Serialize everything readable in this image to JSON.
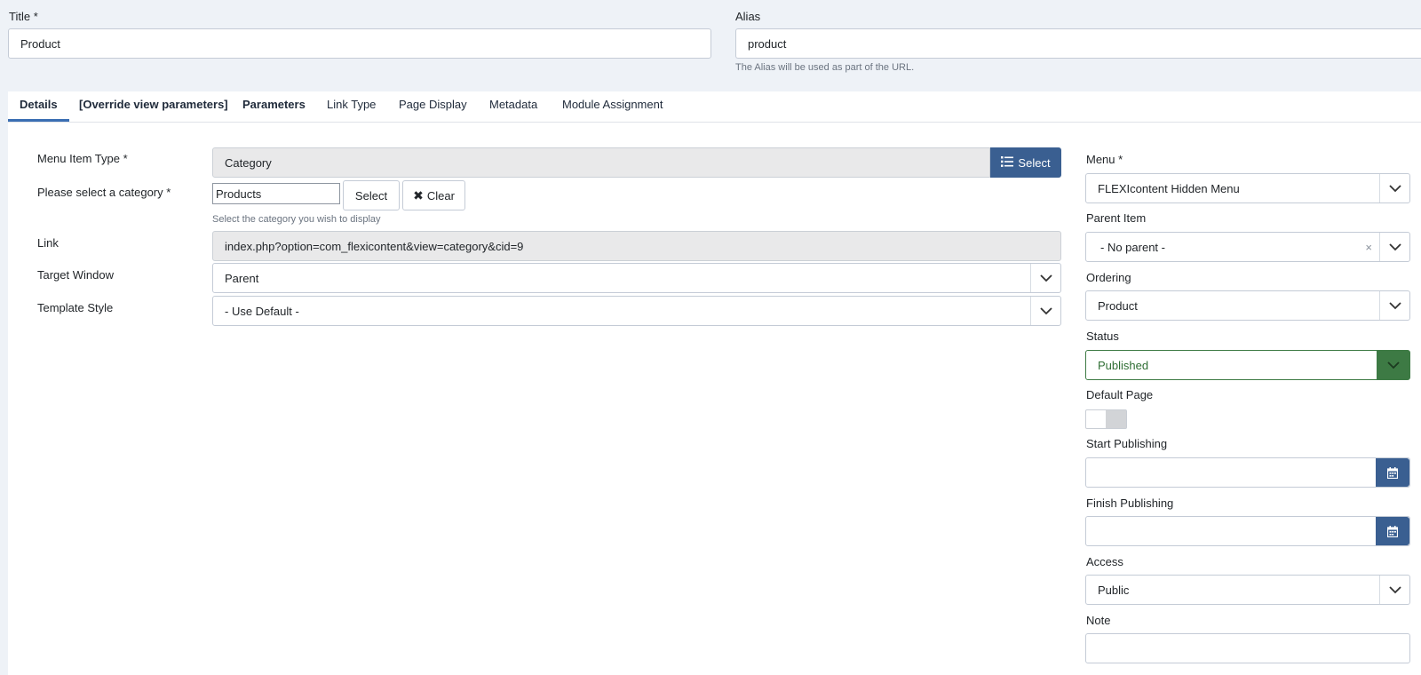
{
  "header": {
    "title_label": "Title *",
    "title_value": "Product",
    "alias_label": "Alias",
    "alias_value": "product",
    "alias_help": "The Alias will be used as part of the URL."
  },
  "tabs": [
    {
      "label": "Details"
    },
    {
      "label": "[Override view parameters]"
    },
    {
      "label": "Parameters"
    },
    {
      "label": "Link Type"
    },
    {
      "label": "Page Display"
    },
    {
      "label": "Metadata"
    },
    {
      "label": "Module Assignment"
    }
  ],
  "details": {
    "menu_item_type_label": "Menu Item Type *",
    "menu_item_type_value": "Category",
    "menu_item_type_button": "Select",
    "category_label": "Please select a category *",
    "category_value": "Products",
    "category_select": "Select",
    "category_clear": "Clear",
    "category_help": "Select the category you wish to display",
    "link_label": "Link",
    "link_value": "index.php?option=com_flexicontent&view=category&cid=9",
    "target_label": "Target Window",
    "target_value": "Parent",
    "template_label": "Template Style",
    "template_value": "- Use Default -"
  },
  "sidebar": {
    "menu_label": "Menu *",
    "menu_value": "FLEXIcontent Hidden Menu",
    "parent_label": "Parent Item",
    "parent_value": "- No parent -",
    "parent_clear": "×",
    "ordering_label": "Ordering",
    "ordering_value": "Product",
    "status_label": "Status",
    "status_value": "Published",
    "default_page_label": "Default Page",
    "start_label": "Start Publishing",
    "start_value": "",
    "finish_label": "Finish Publishing",
    "finish_value": "",
    "access_label": "Access",
    "access_value": "Public",
    "note_label": "Note",
    "note_value": ""
  },
  "colors": {
    "primary": "#3a5f91",
    "success": "#3d7a44",
    "tab_active": "#3a6eb3"
  }
}
